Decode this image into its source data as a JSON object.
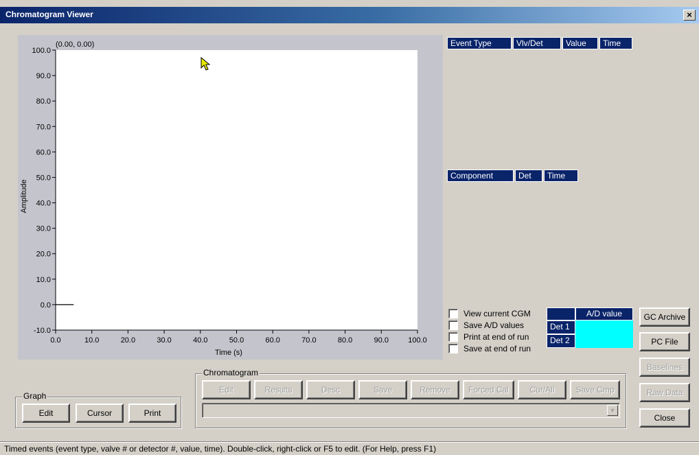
{
  "window": {
    "title": "Chromatogram Viewer",
    "close_glyph": "×"
  },
  "chart_data": {
    "type": "line",
    "title": "",
    "cursor_readout": "(0.00, 0.00)",
    "xlabel": "Time (s)",
    "ylabel": "Amplitude",
    "xlim": [
      0,
      100
    ],
    "ylim": [
      -10,
      100
    ],
    "x_ticks": [
      "0.0",
      "10.0",
      "20.0",
      "30.0",
      "40.0",
      "50.0",
      "60.0",
      "70.0",
      "80.0",
      "90.0",
      "100.0"
    ],
    "y_ticks": [
      "100.0",
      "90.0",
      "80.0",
      "70.0",
      "60.0",
      "50.0",
      "40.0",
      "30.0",
      "20.0",
      "10.0",
      "0.0",
      "-10.0"
    ],
    "series": [
      {
        "x": [
          0,
          5
        ],
        "y": [
          0,
          0
        ],
        "color": "#000000"
      }
    ],
    "grid": false,
    "plot_background": "#ffffff"
  },
  "events_grid": {
    "headers": [
      "Event Type",
      "Vlv/Det",
      "Value",
      "Time"
    ]
  },
  "components_grid": {
    "headers": [
      "Component",
      "Det",
      "Time"
    ]
  },
  "options": {
    "view_current": "View current CGM",
    "save_ad": "Save A/D values",
    "print_end": "Print at end of run",
    "save_end": "Save at end of run"
  },
  "ad_table": {
    "header": "A/D value",
    "rows": [
      "Det 1",
      "Det 2"
    ]
  },
  "side_buttons": {
    "gc_archive": "GC Archive",
    "pc_file": "PC File",
    "baselines": "Baselines",
    "raw_data": "Raw Data",
    "close": "Close"
  },
  "graph_group": {
    "label": "Graph",
    "edit": "Edit",
    "cursor": "Cursor",
    "print": "Print"
  },
  "chromatogram_group": {
    "label": "Chromatogram",
    "edit": "Edit",
    "results": "Results",
    "desc": "Desc",
    "save": "Save",
    "remove": "Remove",
    "forced_cal": "Forced Cal",
    "cur_all": "Cur/All",
    "save_cmp": "Save Cmp",
    "combo_value": ""
  },
  "status": "Timed events (event type, valve # or detector #, value, time).  Double-click, right-click or F5 to edit. (For Help, press F1)",
  "colors": {
    "accent": "#0a246a",
    "cyan": "#00ffff",
    "face": "#d4d0c8"
  }
}
